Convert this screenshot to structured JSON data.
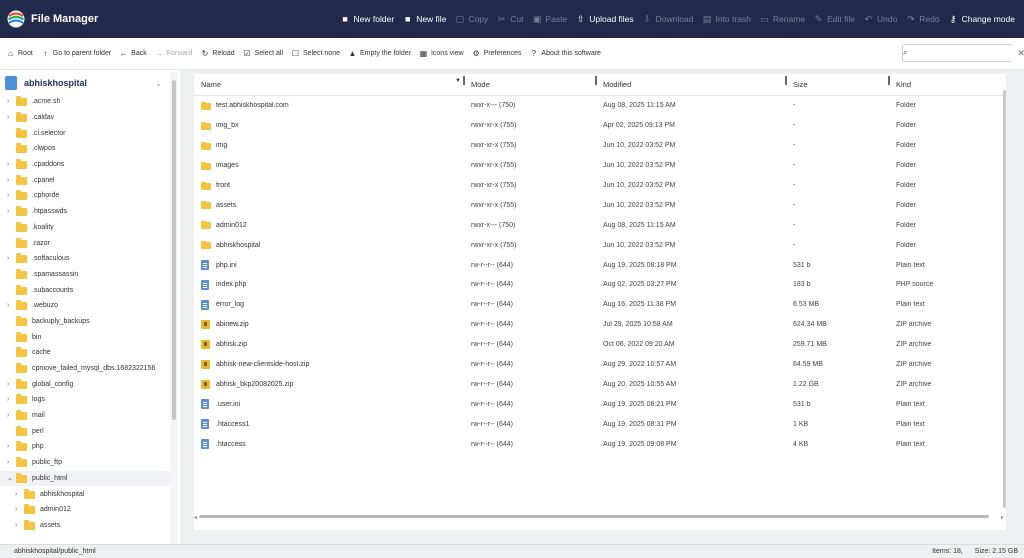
{
  "app": {
    "title": "File Manager"
  },
  "top_actions": [
    {
      "name": "new-folder-button",
      "icon": "folder-plus-icon",
      "glyph": "■",
      "label": "New folder",
      "enabled": true
    },
    {
      "name": "new-file-button",
      "icon": "file-plus-icon",
      "glyph": "■",
      "label": "New file",
      "enabled": true
    },
    {
      "name": "copy-button",
      "icon": "copy-icon",
      "glyph": "▢",
      "label": "Copy",
      "enabled": false
    },
    {
      "name": "cut-button",
      "icon": "scissors-icon",
      "glyph": "✂",
      "label": "Cut",
      "enabled": false
    },
    {
      "name": "paste-button",
      "icon": "clipboard-icon",
      "glyph": "▣",
      "label": "Paste",
      "enabled": false
    },
    {
      "name": "upload-files-button",
      "icon": "upload-icon",
      "glyph": "⇧",
      "label": "Upload files",
      "enabled": true
    },
    {
      "name": "download-button",
      "icon": "download-icon",
      "glyph": "⇩",
      "label": "Download",
      "enabled": false
    },
    {
      "name": "into-trash-button",
      "icon": "trash-icon",
      "glyph": "▤",
      "label": "Into trash",
      "enabled": false
    },
    {
      "name": "rename-button",
      "icon": "rename-icon",
      "glyph": "▭",
      "label": "Rename",
      "enabled": false
    },
    {
      "name": "edit-file-button",
      "icon": "pencil-icon",
      "glyph": "✎",
      "label": "Edit file",
      "enabled": false
    },
    {
      "name": "undo-button",
      "icon": "undo-icon",
      "glyph": "↶",
      "label": "Undo",
      "enabled": false
    },
    {
      "name": "redo-button",
      "icon": "redo-icon",
      "glyph": "↷",
      "label": "Redo",
      "enabled": false
    },
    {
      "name": "change-mode-button",
      "icon": "key-icon",
      "glyph": "⚷",
      "label": "Change mode",
      "enabled": true
    }
  ],
  "toolbar": [
    {
      "name": "root-button",
      "icon": "home-icon",
      "glyph": "⌂",
      "label": "Root",
      "enabled": true
    },
    {
      "name": "parent-folder-button",
      "icon": "arrow-up-icon",
      "glyph": "↑",
      "label": "Go to parent folder",
      "enabled": true
    },
    {
      "name": "back-button",
      "icon": "arrow-left-icon",
      "glyph": "←",
      "label": "Back",
      "enabled": true
    },
    {
      "name": "forward-button",
      "icon": "arrow-right-icon",
      "glyph": "→",
      "label": "Forward",
      "enabled": false
    },
    {
      "name": "reload-button",
      "icon": "refresh-icon",
      "glyph": "↻",
      "label": "Reload",
      "enabled": true
    },
    {
      "name": "select-all-button",
      "icon": "checkbox-checked-icon",
      "glyph": "☑",
      "label": "Select all",
      "enabled": true
    },
    {
      "name": "select-none-button",
      "icon": "checkbox-empty-icon",
      "glyph": "☐",
      "label": "Select none",
      "enabled": true
    },
    {
      "name": "empty-folder-button",
      "icon": "broom-icon",
      "glyph": "▲",
      "label": "Empty the folder",
      "enabled": true
    },
    {
      "name": "icons-view-button",
      "icon": "grid-icon",
      "glyph": "▦",
      "label": "Icons view",
      "enabled": true
    },
    {
      "name": "preferences-button",
      "icon": "gear-icon",
      "glyph": "⚙",
      "label": "Preferences",
      "enabled": true
    },
    {
      "name": "about-button",
      "icon": "help-icon",
      "glyph": "?",
      "label": "About this software",
      "enabled": true
    }
  ],
  "search": {
    "placeholder": "",
    "value": ""
  },
  "sidebar": {
    "root_label": "abhiskhospital",
    "items": [
      {
        "label": ".acme.sh",
        "chev": "›",
        "child": false,
        "active": false
      },
      {
        "label": ".caldav",
        "chev": "›",
        "child": false,
        "active": false
      },
      {
        "label": ".cl.selector",
        "chev": "",
        "child": false,
        "active": false
      },
      {
        "label": ".clwpos",
        "chev": "",
        "child": false,
        "active": false
      },
      {
        "label": ".cpaddons",
        "chev": "›",
        "child": false,
        "active": false
      },
      {
        "label": ".cpanel",
        "chev": "›",
        "child": false,
        "active": false
      },
      {
        "label": ".cphorde",
        "chev": "›",
        "child": false,
        "active": false
      },
      {
        "label": ".htpasswds",
        "chev": "›",
        "child": false,
        "active": false
      },
      {
        "label": ".koality",
        "chev": "",
        "child": false,
        "active": false
      },
      {
        "label": ".razor",
        "chev": "",
        "child": false,
        "active": false
      },
      {
        "label": ".softaculous",
        "chev": "›",
        "child": false,
        "active": false
      },
      {
        "label": ".spamassassin",
        "chev": "",
        "child": false,
        "active": false
      },
      {
        "label": ".subaccounts",
        "chev": "",
        "child": false,
        "active": false
      },
      {
        "label": ".webuzo",
        "chev": "›",
        "child": false,
        "active": false
      },
      {
        "label": "backuply_backups",
        "chev": "",
        "child": false,
        "active": false
      },
      {
        "label": "bin",
        "chev": "",
        "child": false,
        "active": false
      },
      {
        "label": "cache",
        "chev": "",
        "child": false,
        "active": false
      },
      {
        "label": "cpmove_failed_mysql_dbs.1682322156",
        "chev": "",
        "child": false,
        "active": false
      },
      {
        "label": "global_config",
        "chev": "›",
        "child": false,
        "active": false
      },
      {
        "label": "logs",
        "chev": "›",
        "child": false,
        "active": false
      },
      {
        "label": "mail",
        "chev": "›",
        "child": false,
        "active": false
      },
      {
        "label": "perl",
        "chev": "",
        "child": false,
        "active": false
      },
      {
        "label": "php",
        "chev": "›",
        "child": false,
        "active": false
      },
      {
        "label": "public_ftp",
        "chev": "›",
        "child": false,
        "active": false
      },
      {
        "label": "public_html",
        "chev": "⌄",
        "child": false,
        "active": true
      },
      {
        "label": "abhiskhospital",
        "chev": "›",
        "child": true,
        "active": false
      },
      {
        "label": "admin012",
        "chev": "›",
        "child": true,
        "active": false
      },
      {
        "label": "assets",
        "chev": "›",
        "child": true,
        "active": false
      }
    ]
  },
  "table": {
    "columns": {
      "name": "Name",
      "mode": "Mode",
      "modified": "Modified",
      "size": "Size",
      "kind": "Kind"
    },
    "rows": [
      {
        "type": "folder",
        "name": "test.abhiskhospital.com",
        "mode": "rwxr-x--- (750)",
        "modified": "Aug 08, 2025 11:15 AM",
        "size": "-",
        "kind": "Folder"
      },
      {
        "type": "folder",
        "name": "img_bx",
        "mode": "rwxr-xr-x (755)",
        "modified": "Apr 02, 2025 09:13 PM",
        "size": "-",
        "kind": "Folder"
      },
      {
        "type": "folder",
        "name": "img",
        "mode": "rwxr-xr-x (755)",
        "modified": "Jun 10, 2022 03:52 PM",
        "size": "-",
        "kind": "Folder"
      },
      {
        "type": "folder",
        "name": "images",
        "mode": "rwxr-xr-x (755)",
        "modified": "Jun 10, 2022 03:52 PM",
        "size": "-",
        "kind": "Folder"
      },
      {
        "type": "folder",
        "name": "front",
        "mode": "rwxr-xr-x (755)",
        "modified": "Jun 10, 2022 03:52 PM",
        "size": "-",
        "kind": "Folder"
      },
      {
        "type": "folder",
        "name": "assets",
        "mode": "rwxr-xr-x (755)",
        "modified": "Jun 10, 2022 03:52 PM",
        "size": "-",
        "kind": "Folder"
      },
      {
        "type": "folder",
        "name": "admin012",
        "mode": "rwxr-x--- (750)",
        "modified": "Aug 08, 2025 11:15 AM",
        "size": "-",
        "kind": "Folder"
      },
      {
        "type": "folder",
        "name": "abhiskhospital",
        "mode": "rwxr-xr-x (755)",
        "modified": "Jun 10, 2022 03:52 PM",
        "size": "-",
        "kind": "Folder"
      },
      {
        "type": "text",
        "name": "php.ini",
        "mode": "rw-r--r-- (644)",
        "modified": "Aug 19, 2025 08:18 PM",
        "size": "531 b",
        "kind": "Plain text"
      },
      {
        "type": "php",
        "name": "index.php",
        "mode": "rw-r--r-- (644)",
        "modified": "Aug 02, 2025 03:27 PM",
        "size": "183 b",
        "kind": "PHP source"
      },
      {
        "type": "text",
        "name": "error_log",
        "mode": "rw-r--r-- (644)",
        "modified": "Aug 16, 2025 11:38 PM",
        "size": "6.53 MB",
        "kind": "Plain text"
      },
      {
        "type": "zip",
        "name": "abinew.zip",
        "mode": "rw-r--r-- (644)",
        "modified": "Jul 29, 2025 10:58 AM",
        "size": "624.34 MB",
        "kind": "ZIP archive"
      },
      {
        "type": "zip",
        "name": "abhisk.zip",
        "mode": "rw-r--r-- (644)",
        "modified": "Oct 06, 2022 09:20 AM",
        "size": "259.71 MB",
        "kind": "ZIP archive"
      },
      {
        "type": "zip",
        "name": "abhisk-new-clientside-host.zip",
        "mode": "rw-r--r-- (644)",
        "modified": "Aug 29, 2022 10:57 AM",
        "size": "64.59 MB",
        "kind": "ZIP archive"
      },
      {
        "type": "zip",
        "name": "abhisk_bkp20082025.zip",
        "mode": "rw-r--r-- (644)",
        "modified": "Aug 20, 2025 10:55 AM",
        "size": "1.22 GB",
        "kind": "ZIP archive"
      },
      {
        "type": "text",
        "name": ".user.ini",
        "mode": "rw-r--r-- (644)",
        "modified": "Aug 19, 2025 08:21 PM",
        "size": "531 b",
        "kind": "Plain text"
      },
      {
        "type": "text",
        "name": ".htaccess1",
        "mode": "rw-r--r-- (644)",
        "modified": "Aug 19, 2025 08:31 PM",
        "size": "1 KB",
        "kind": "Plain text"
      },
      {
        "type": "text",
        "name": ".htaccess",
        "mode": "rw-r--r-- (644)",
        "modified": "Aug 19, 2025 09:08 PM",
        "size": "4 KB",
        "kind": "Plain text"
      }
    ]
  },
  "status": {
    "path": "abhiskhospital/public_html",
    "items": "Items: 18,",
    "size": "Size: 2.15 GB"
  }
}
